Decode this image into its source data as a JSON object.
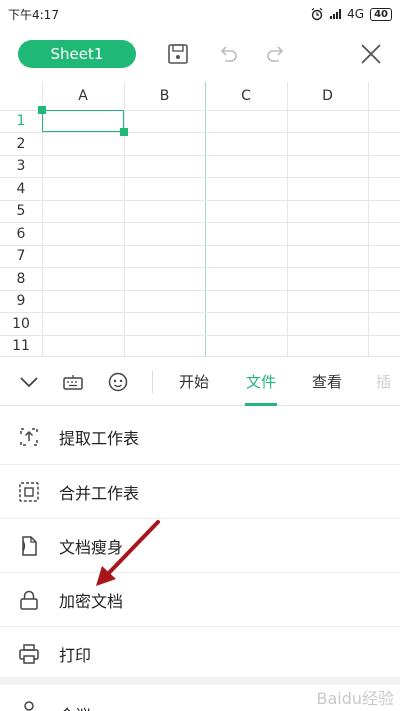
{
  "status_bar": {
    "time": "下午4:17",
    "network": "4G",
    "battery": "40"
  },
  "toolbar": {
    "sheet_label": "Sheet1"
  },
  "grid": {
    "columns": [
      "A",
      "B",
      "C",
      "D"
    ],
    "rows": [
      "1",
      "2",
      "3",
      "4",
      "5",
      "6",
      "7",
      "8",
      "9",
      "10",
      "11"
    ],
    "selected_cell": "A1"
  },
  "tabs": [
    "开始",
    "文件",
    "查看",
    "插"
  ],
  "active_tab": "文件",
  "menu": [
    {
      "label": "提取工作表",
      "icon": "extract-sheet-icon"
    },
    {
      "label": "合并工作表",
      "icon": "merge-sheet-icon"
    },
    {
      "label": "文档瘦身",
      "icon": "slim-doc-icon"
    },
    {
      "label": "加密文档",
      "icon": "lock-icon"
    },
    {
      "label": "打印",
      "icon": "printer-icon"
    },
    {
      "label": "会议",
      "icon": "meeting-icon"
    }
  ],
  "annotation_color": "#a8161b",
  "accent_color": "#1fb877",
  "watermark": "Baidu经验"
}
